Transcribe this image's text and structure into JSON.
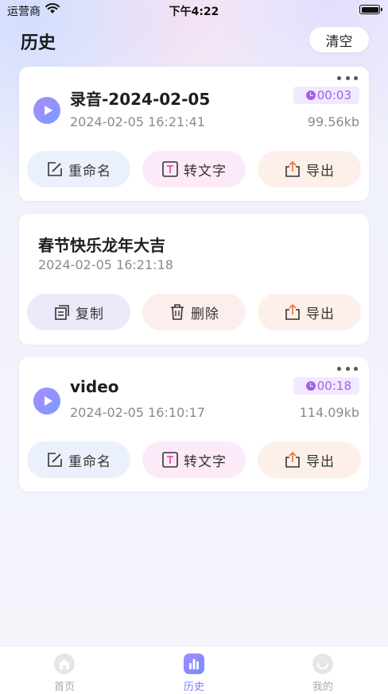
{
  "status_bar": {
    "carrier": "运营商",
    "time": "下午4:22"
  },
  "header": {
    "title": "历史",
    "clear_label": "清空"
  },
  "recordings": [
    {
      "title": "录音-2024-02-05",
      "datetime": "2024-02-05 16:21:41",
      "duration": "00:03",
      "size": "99.56kb",
      "actions": [
        "重命名",
        "转文字",
        "导出"
      ]
    },
    {
      "title": "春节快乐龙年大吉",
      "datetime": "2024-02-05 16:21:18",
      "actions": [
        "复制",
        "删除",
        "导出"
      ]
    },
    {
      "title": "video",
      "datetime": "2024-02-05 16:10:17",
      "duration": "00:18",
      "size": "114.09kb",
      "actions": [
        "重命名",
        "转文字",
        "导出"
      ]
    }
  ],
  "tab_bar": {
    "items": [
      {
        "label": "首页",
        "icon": "home-icon"
      },
      {
        "label": "历史",
        "icon": "history-chart-icon",
        "active": true
      },
      {
        "label": "我的",
        "icon": "profile-icon"
      }
    ]
  },
  "colors": {
    "accent": "#7a7ff0",
    "duration": "#a160e8",
    "play_start": "#a88cff",
    "play_end": "#7a9bff"
  }
}
